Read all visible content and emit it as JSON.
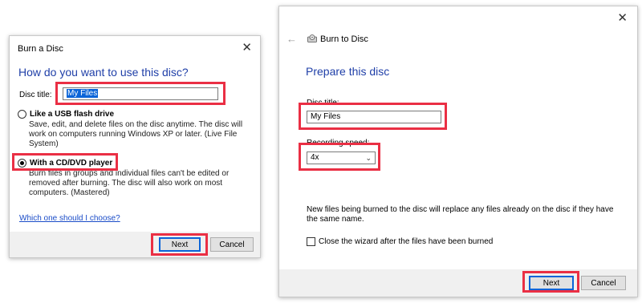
{
  "burn_dialog": {
    "title": "Burn a Disc",
    "close_glyph": "✕",
    "heading": "How do you want to use this disc?",
    "disc_title_label": "Disc title:",
    "disc_title_value": "My Files",
    "option_usb": {
      "label": "Like a USB flash drive",
      "description": "Save, edit, and delete files on the disc anytime. The disc will work on computers running Windows XP or later. (Live File System)",
      "checked": false
    },
    "option_cd": {
      "label": "With a CD/DVD player",
      "description": "Burn files in groups and individual files can't be edited or removed after burning. The disc will also work on most computers. (Mastered)",
      "checked": true
    },
    "help_link": "Which one should I choose?",
    "next_label": "Next",
    "cancel_label": "Cancel"
  },
  "burn_wizard": {
    "title": "Burn to Disc",
    "close_glyph": "✕",
    "back_glyph": "←",
    "heading": "Prepare this disc",
    "disc_title_label": "Disc title:",
    "disc_title_value": "My Files",
    "speed_label": "Recording speed:",
    "speed_value": "4x",
    "chevron_glyph": "⌄",
    "note": "New files being burned to the disc will replace any files already on the disc if they have the same name.",
    "close_wizard_label": "Close the wizard after the files have been burned",
    "close_wizard_checked": false,
    "next_label": "Next",
    "cancel_label": "Cancel"
  },
  "colors": {
    "highlight": "#ea2f44",
    "heading_blue": "#1f3fa8",
    "link_blue": "#1a4cc8",
    "selection_blue": "#0a64d8",
    "footer_gray": "#f0f0f0"
  },
  "icons": {
    "close": "close-icon",
    "back": "back-arrow-icon",
    "disc": "disc-drive-icon",
    "dropdown": "chevron-down-icon"
  }
}
